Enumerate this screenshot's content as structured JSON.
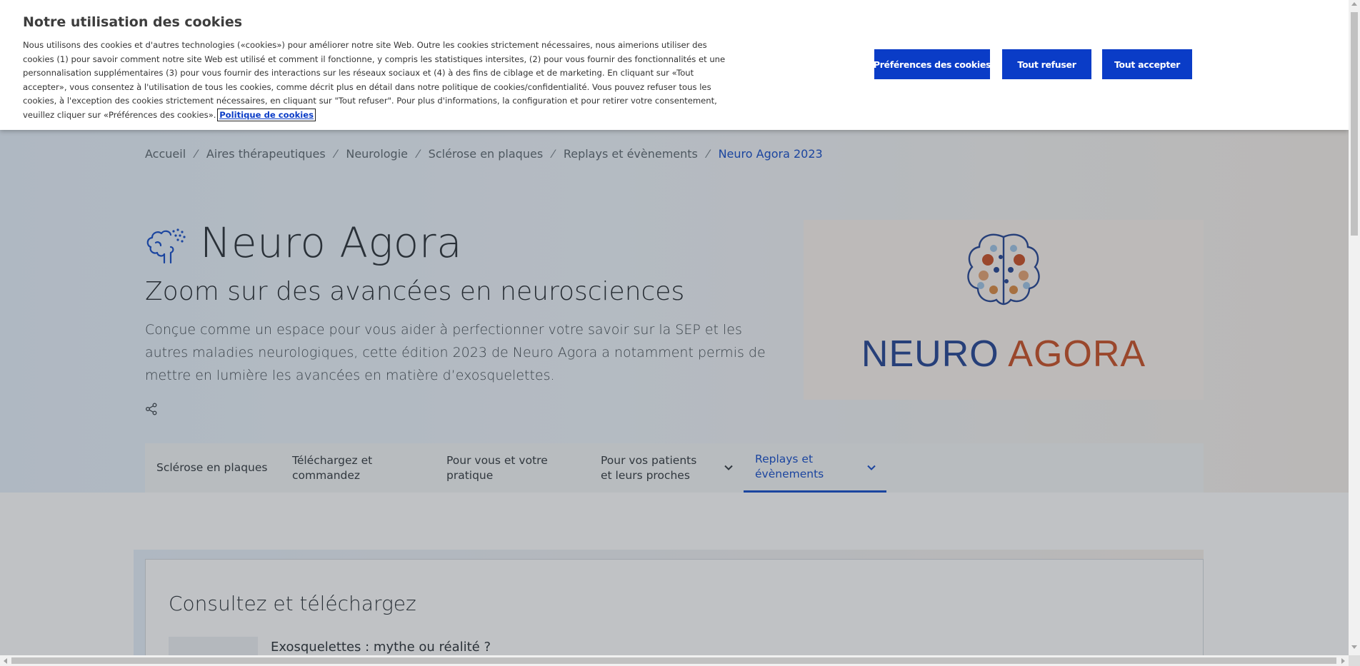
{
  "cookie_banner": {
    "title": "Notre utilisation des cookies",
    "text": "Nous utilisons des cookies et d'autres technologies («cookies») pour améliorer notre site Web. Outre les cookies strictement nécessaires, nous aimerions utiliser des cookies (1) pour savoir comment notre site Web est utilisé et comment il fonctionne, y compris les statistiques intersites, (2) pour vous fournir des fonctionnalités et une personnalisation supplémentaires (3) pour vous fournir des interactions sur les réseaux sociaux et (4) à des fins de ciblage et de marketing. En cliquant sur «Tout accepter», vous consentez à l'utilisation de tous les cookies, comme décrit plus en détail dans notre politique de cookies/confidentialité. Vous pouvez refuser tous les cookies, à l'exception des cookies strictement nécessaires, en cliquant sur \"Tout refuser\". Pour plus d'informations, la configuration et pour retirer votre consentement, veuillez cliquer sur «Préférences des cookies».",
    "policy_link": "Politique de cookies",
    "buttons": {
      "preferences": "Préférences des cookies",
      "refuse_all": "Tout refuser",
      "accept_all": "Tout accepter"
    },
    "button_color": "#0a3cc7"
  },
  "breadcrumb": [
    "Accueil",
    "Aires thérapeutiques",
    "Neurologie",
    "Sclérose en plaques",
    "Replays et évènements",
    "Neuro Agora 2023"
  ],
  "breadcrumb_separator": "⁄",
  "hero": {
    "title": "Neuro Agora",
    "subtitle": "Zoom sur des avancées en neurosciences",
    "description": "Conçue comme un espace pour vous aider à perfectionner votre savoir sur la SEP et les autres maladies neurologiques, cette édition 2023 de Neuro Agora a notamment permis de mettre en lumière les avancées en matière d’exosquelettes.",
    "logo": {
      "word1": "NEURO",
      "word2": "AGORA",
      "word1_color": "#1d3f8f",
      "word2_color": "#c84a1e"
    }
  },
  "tabs": [
    {
      "label": "Sclérose en plaques",
      "dropdown": false,
      "active": false
    },
    {
      "label": "Téléchargez et\ncommandez",
      "dropdown": false,
      "active": false
    },
    {
      "label": "Pour vous et votre\npratique",
      "dropdown": false,
      "active": false
    },
    {
      "label": "Pour vos patients\net leurs proches",
      "dropdown": true,
      "active": false
    },
    {
      "label": "Replays et\névènements",
      "dropdown": true,
      "active": true
    }
  ],
  "consult_section": {
    "title": "Consultez et téléchargez",
    "first_item_title": "Exosquelettes : mythe ou réalité ?"
  },
  "accent_color": "#0d47c7"
}
